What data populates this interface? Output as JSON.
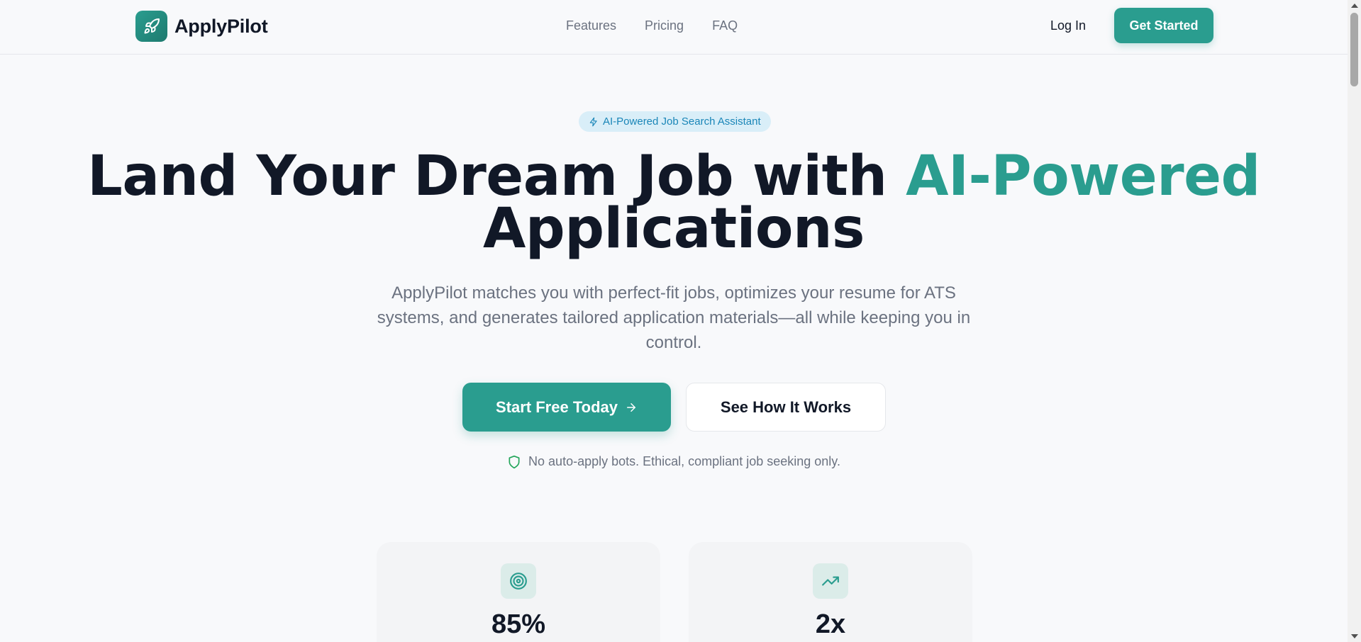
{
  "header": {
    "brand_name": "ApplyPilot",
    "brand_icon": "rocket-icon",
    "nav": [
      "Features",
      "Pricing",
      "FAQ"
    ],
    "login_label": "Log In",
    "cta_label": "Get Started"
  },
  "hero": {
    "badge": "AI-Powered Job Search Assistant",
    "headline_part1": "Land Your Dream Job with ",
    "headline_accent": "AI-Powered",
    "headline_part2": " Applications",
    "subheadline": "ApplyPilot matches you with perfect-fit jobs, optimizes your resume for ATS systems, and generates tailored application materials—all while keeping you in control.",
    "primary_cta": "Start Free Today",
    "secondary_cta": "See How It Works",
    "trust_note": "No auto-apply bots. Ethical, compliant job seeking only."
  },
  "stats": [
    {
      "icon": "target-icon",
      "value": "85%"
    },
    {
      "icon": "trending-up-icon",
      "value": "2x"
    }
  ],
  "colors": {
    "accent": "#2a9d8f",
    "badge_bg": "#d9eef8",
    "badge_text": "#1a86b8",
    "shield": "#22a55a"
  }
}
